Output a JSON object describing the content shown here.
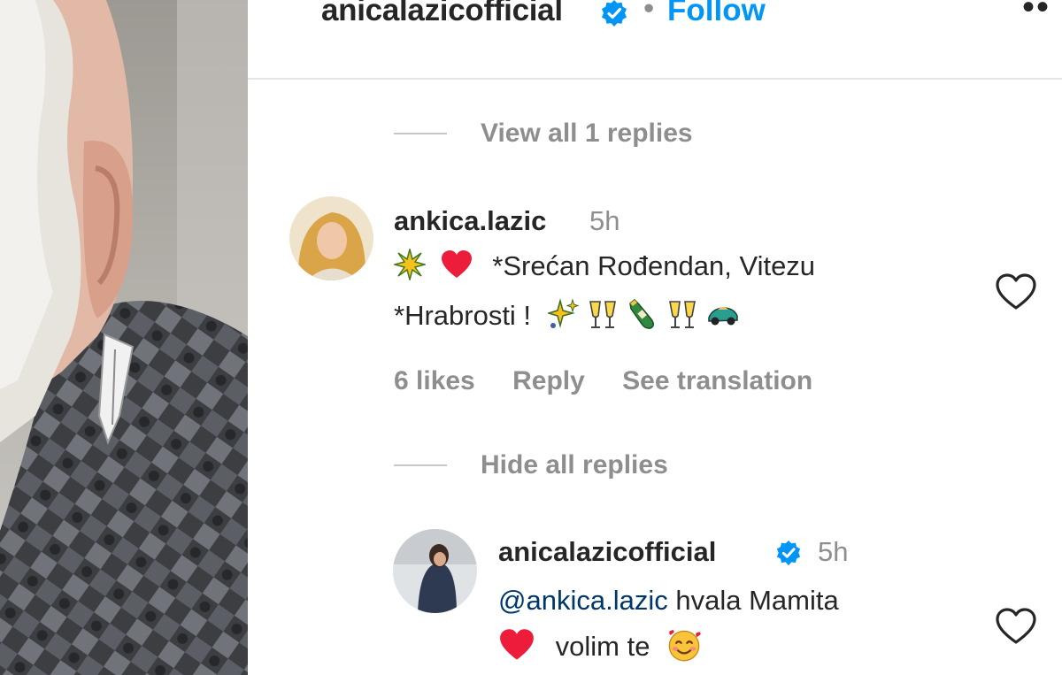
{
  "post_header": {
    "username": "anicalazicofficial",
    "separator": "•",
    "follow_label": "Follow",
    "more_label": "••"
  },
  "replies_toggle_top": {
    "label": "View all 1 replies"
  },
  "comment": {
    "username": "ankica.lazic",
    "time": "5h",
    "text_line1": "*Srećan Rođendan, Vitezu",
    "text_line2": "*Hrabrosti !",
    "emojis_line1": [
      "sparkle-star-icon",
      "red-heart-icon"
    ],
    "emojis_line2": [
      "sparkles-icon",
      "clinking-glasses-icon",
      "champagne-bottle-icon",
      "clinking-glasses-icon",
      "racing-car-icon"
    ],
    "likes": "6 likes",
    "reply_label": "Reply",
    "translate_label": "See translation"
  },
  "replies_toggle_bottom": {
    "label": "Hide all replies"
  },
  "reply": {
    "username": "anicalazicofficial",
    "time": "5h",
    "mention": "@ankica.lazic",
    "text_line1": "hvala Mamita",
    "text_line2": "volim te",
    "emojis": [
      "red-heart-icon",
      "smiling-face-with-hearts-icon"
    ]
  },
  "colors": {
    "link_blue": "#0095f6",
    "mention_blue": "#00376b",
    "muted_gray": "#8e8e8e",
    "text": "#262626",
    "heart_red": "#ed1c3b"
  }
}
